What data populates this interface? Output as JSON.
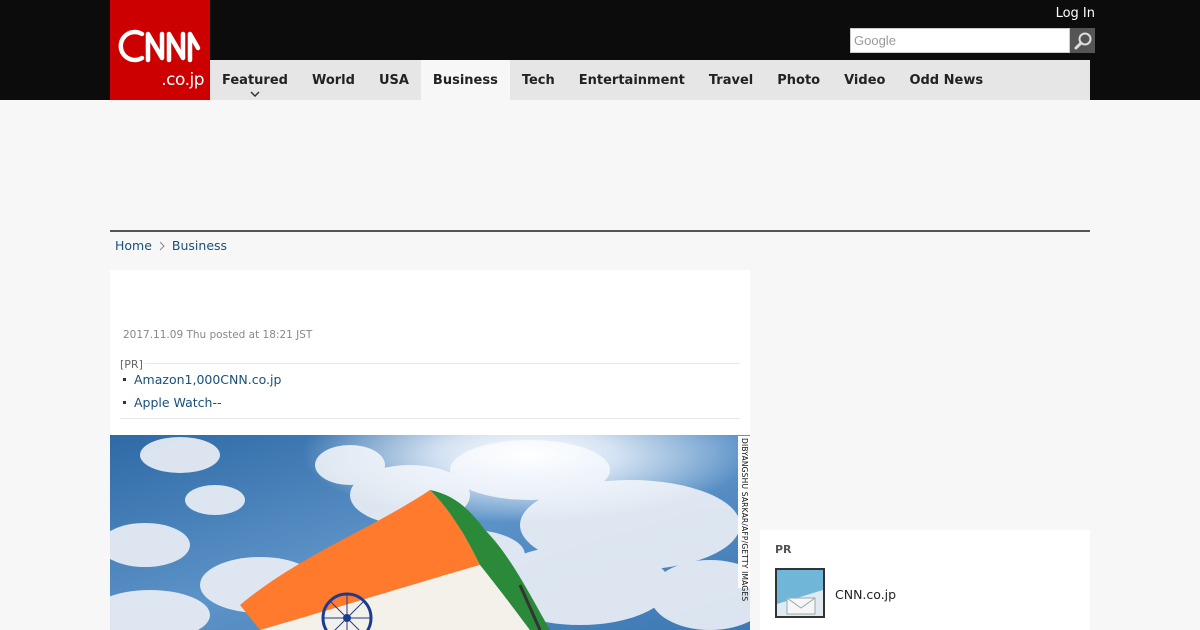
{
  "header": {
    "logo_main": "CNN",
    "logo_sub": ".co.jp",
    "login_label": "Log In",
    "search_placeholder": "Google"
  },
  "nav": {
    "items": [
      {
        "label": "Featured"
      },
      {
        "label": "World"
      },
      {
        "label": "USA"
      },
      {
        "label": "Business"
      },
      {
        "label": "Tech"
      },
      {
        "label": "Entertainment"
      },
      {
        "label": "Travel"
      },
      {
        "label": "Photo"
      },
      {
        "label": "Video"
      },
      {
        "label": "Odd News"
      }
    ],
    "active": "Business"
  },
  "breadcrumb": {
    "home": "Home",
    "current": "Business"
  },
  "article": {
    "date": "2017.11.09 Thu posted at 18:21 JST",
    "pr_label": "[PR]",
    "pr_links": [
      "Amazon1,000CNN.co.jp",
      "Apple Watch--"
    ],
    "photo_credit": "DIBYANGSHU SARKAR/AFP/GETTY IMAGES"
  },
  "sidebar": {
    "pr_label": "PR",
    "item_text": "CNN.co.jp"
  },
  "colors": {
    "brand_red": "#cc0000",
    "header_black": "#0c0c0c",
    "link_blue": "#1a4f7a"
  }
}
